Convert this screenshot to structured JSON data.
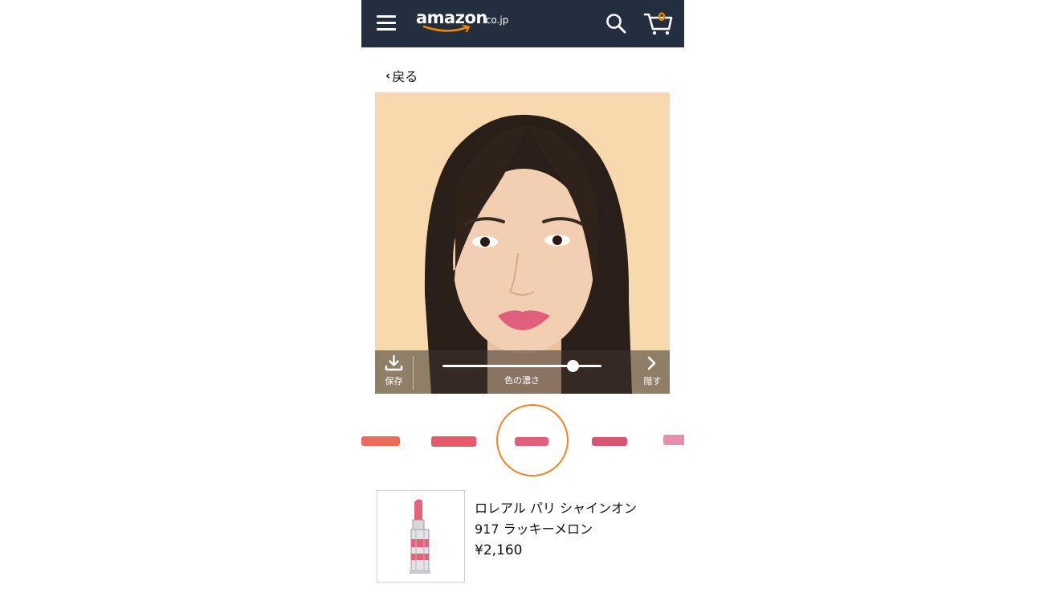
{
  "header": {
    "logo_text": "amazon",
    "logo_suffix": ".co.jp",
    "cart_count": "0",
    "icons": [
      "menu-icon",
      "search-icon",
      "cart-icon"
    ],
    "bar_color": "#232f3e",
    "accent_color": "#f08804"
  },
  "nav": {
    "back_label": "戻る"
  },
  "tryon": {
    "save_label": "保存",
    "slider_label": "色の濃さ",
    "slider_value": 0.82,
    "hide_label": "隠す"
  },
  "swatches": {
    "colors": [
      "#ee6a5a",
      "#e9576a",
      "#e0607c",
      "#d65673",
      "#e88ea8"
    ],
    "selected_index": 2,
    "selection_color": "#f0862a"
  },
  "product": {
    "name_line1": "ロレアル パリ シャインオン",
    "name_line2": "917 ラッキーメロン",
    "price": "¥2,160"
  }
}
